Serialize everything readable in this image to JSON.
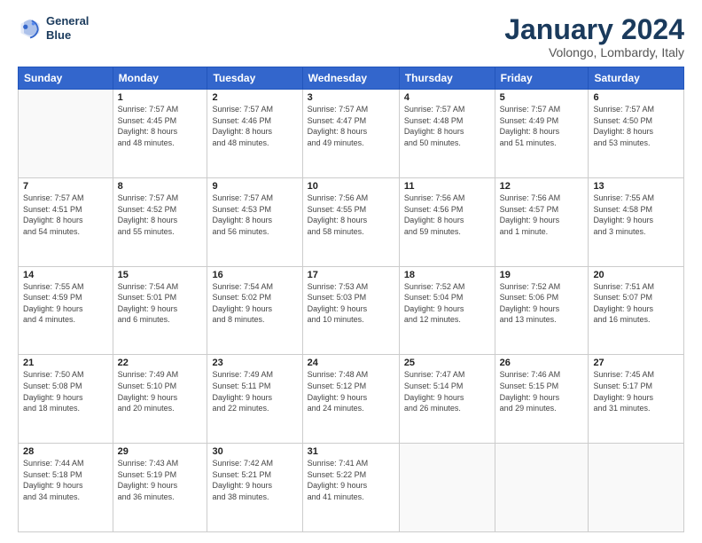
{
  "header": {
    "logo_line1": "General",
    "logo_line2": "Blue",
    "month_title": "January 2024",
    "location": "Volongo, Lombardy, Italy"
  },
  "weekdays": [
    "Sunday",
    "Monday",
    "Tuesday",
    "Wednesday",
    "Thursday",
    "Friday",
    "Saturday"
  ],
  "weeks": [
    [
      {
        "day": "",
        "info": ""
      },
      {
        "day": "1",
        "info": "Sunrise: 7:57 AM\nSunset: 4:45 PM\nDaylight: 8 hours\nand 48 minutes."
      },
      {
        "day": "2",
        "info": "Sunrise: 7:57 AM\nSunset: 4:46 PM\nDaylight: 8 hours\nand 48 minutes."
      },
      {
        "day": "3",
        "info": "Sunrise: 7:57 AM\nSunset: 4:47 PM\nDaylight: 8 hours\nand 49 minutes."
      },
      {
        "day": "4",
        "info": "Sunrise: 7:57 AM\nSunset: 4:48 PM\nDaylight: 8 hours\nand 50 minutes."
      },
      {
        "day": "5",
        "info": "Sunrise: 7:57 AM\nSunset: 4:49 PM\nDaylight: 8 hours\nand 51 minutes."
      },
      {
        "day": "6",
        "info": "Sunrise: 7:57 AM\nSunset: 4:50 PM\nDaylight: 8 hours\nand 53 minutes."
      }
    ],
    [
      {
        "day": "7",
        "info": "Sunrise: 7:57 AM\nSunset: 4:51 PM\nDaylight: 8 hours\nand 54 minutes."
      },
      {
        "day": "8",
        "info": "Sunrise: 7:57 AM\nSunset: 4:52 PM\nDaylight: 8 hours\nand 55 minutes."
      },
      {
        "day": "9",
        "info": "Sunrise: 7:57 AM\nSunset: 4:53 PM\nDaylight: 8 hours\nand 56 minutes."
      },
      {
        "day": "10",
        "info": "Sunrise: 7:56 AM\nSunset: 4:55 PM\nDaylight: 8 hours\nand 58 minutes."
      },
      {
        "day": "11",
        "info": "Sunrise: 7:56 AM\nSunset: 4:56 PM\nDaylight: 8 hours\nand 59 minutes."
      },
      {
        "day": "12",
        "info": "Sunrise: 7:56 AM\nSunset: 4:57 PM\nDaylight: 9 hours\nand 1 minute."
      },
      {
        "day": "13",
        "info": "Sunrise: 7:55 AM\nSunset: 4:58 PM\nDaylight: 9 hours\nand 3 minutes."
      }
    ],
    [
      {
        "day": "14",
        "info": "Sunrise: 7:55 AM\nSunset: 4:59 PM\nDaylight: 9 hours\nand 4 minutes."
      },
      {
        "day": "15",
        "info": "Sunrise: 7:54 AM\nSunset: 5:01 PM\nDaylight: 9 hours\nand 6 minutes."
      },
      {
        "day": "16",
        "info": "Sunrise: 7:54 AM\nSunset: 5:02 PM\nDaylight: 9 hours\nand 8 minutes."
      },
      {
        "day": "17",
        "info": "Sunrise: 7:53 AM\nSunset: 5:03 PM\nDaylight: 9 hours\nand 10 minutes."
      },
      {
        "day": "18",
        "info": "Sunrise: 7:52 AM\nSunset: 5:04 PM\nDaylight: 9 hours\nand 12 minutes."
      },
      {
        "day": "19",
        "info": "Sunrise: 7:52 AM\nSunset: 5:06 PM\nDaylight: 9 hours\nand 13 minutes."
      },
      {
        "day": "20",
        "info": "Sunrise: 7:51 AM\nSunset: 5:07 PM\nDaylight: 9 hours\nand 16 minutes."
      }
    ],
    [
      {
        "day": "21",
        "info": "Sunrise: 7:50 AM\nSunset: 5:08 PM\nDaylight: 9 hours\nand 18 minutes."
      },
      {
        "day": "22",
        "info": "Sunrise: 7:49 AM\nSunset: 5:10 PM\nDaylight: 9 hours\nand 20 minutes."
      },
      {
        "day": "23",
        "info": "Sunrise: 7:49 AM\nSunset: 5:11 PM\nDaylight: 9 hours\nand 22 minutes."
      },
      {
        "day": "24",
        "info": "Sunrise: 7:48 AM\nSunset: 5:12 PM\nDaylight: 9 hours\nand 24 minutes."
      },
      {
        "day": "25",
        "info": "Sunrise: 7:47 AM\nSunset: 5:14 PM\nDaylight: 9 hours\nand 26 minutes."
      },
      {
        "day": "26",
        "info": "Sunrise: 7:46 AM\nSunset: 5:15 PM\nDaylight: 9 hours\nand 29 minutes."
      },
      {
        "day": "27",
        "info": "Sunrise: 7:45 AM\nSunset: 5:17 PM\nDaylight: 9 hours\nand 31 minutes."
      }
    ],
    [
      {
        "day": "28",
        "info": "Sunrise: 7:44 AM\nSunset: 5:18 PM\nDaylight: 9 hours\nand 34 minutes."
      },
      {
        "day": "29",
        "info": "Sunrise: 7:43 AM\nSunset: 5:19 PM\nDaylight: 9 hours\nand 36 minutes."
      },
      {
        "day": "30",
        "info": "Sunrise: 7:42 AM\nSunset: 5:21 PM\nDaylight: 9 hours\nand 38 minutes."
      },
      {
        "day": "31",
        "info": "Sunrise: 7:41 AM\nSunset: 5:22 PM\nDaylight: 9 hours\nand 41 minutes."
      },
      {
        "day": "",
        "info": ""
      },
      {
        "day": "",
        "info": ""
      },
      {
        "day": "",
        "info": ""
      }
    ]
  ]
}
